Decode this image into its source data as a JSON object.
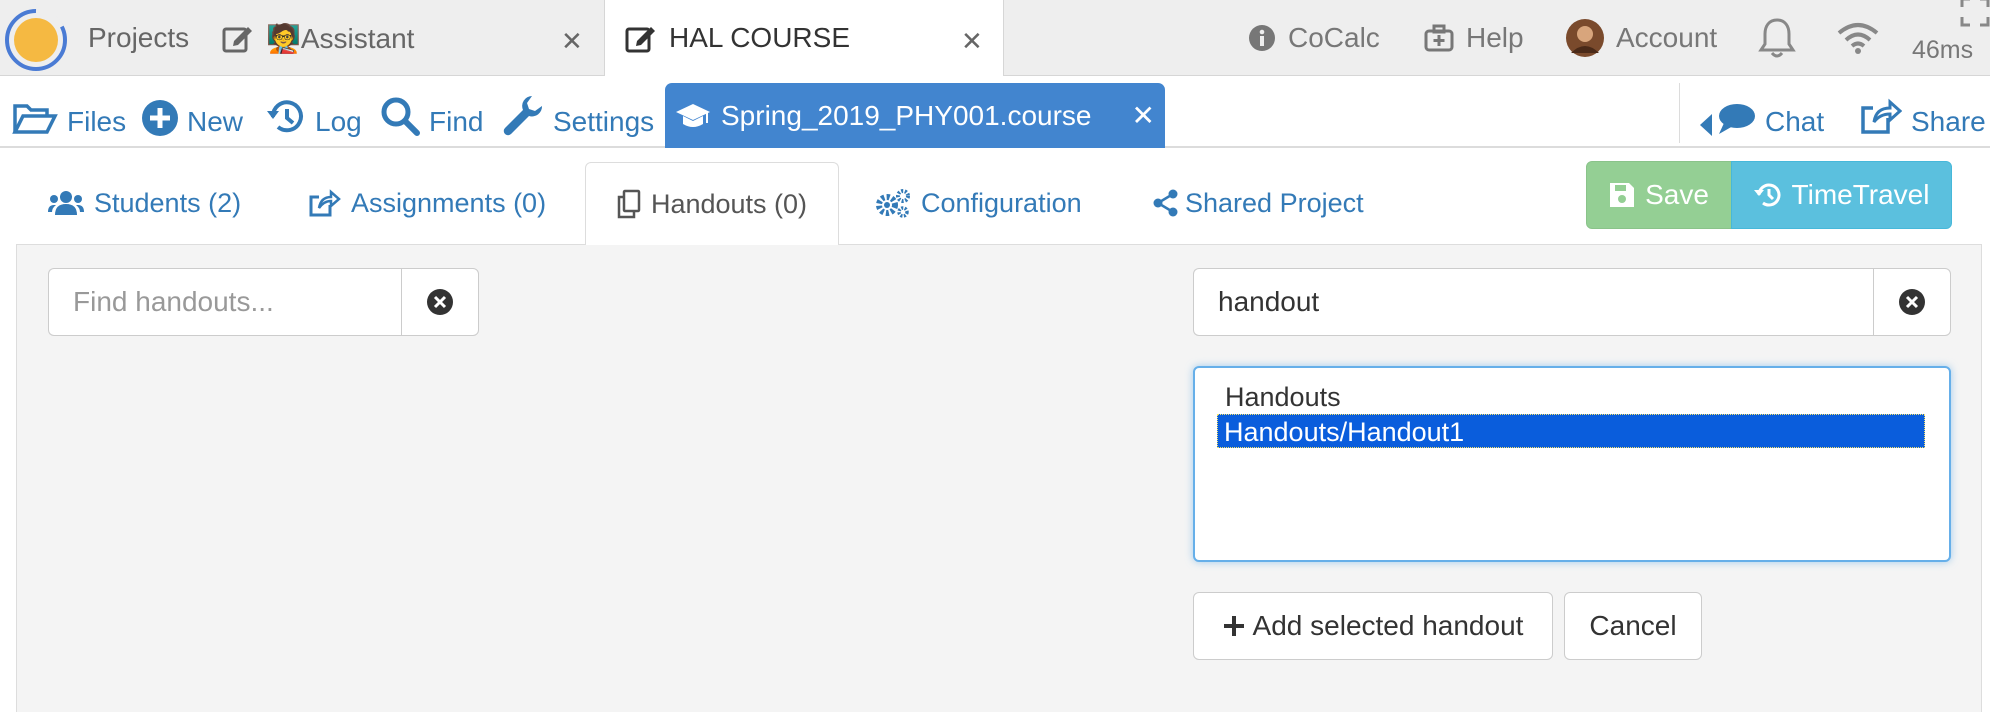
{
  "topbar": {
    "tabs": [
      {
        "label": "Projects"
      },
      {
        "label": "🧑‍🏫Assistant"
      },
      {
        "label": "HAL COURSE"
      }
    ],
    "right": {
      "cocalc": "CoCalc",
      "help": "Help",
      "account": "Account",
      "ping": "46ms"
    }
  },
  "project_toolbar": {
    "files": "Files",
    "new": "New",
    "log": "Log",
    "find": "Find",
    "settings": "Settings",
    "open_file": "Spring_2019_PHY001.course",
    "chat": "Chat",
    "share": "Share"
  },
  "course_tabs": {
    "students": "Students (2)",
    "assignments": "Assignments (0)",
    "handouts": "Handouts (0)",
    "configuration": "Configuration",
    "shared_project": "Shared Project"
  },
  "actions": {
    "save": "Save",
    "timetravel": "TimeTravel"
  },
  "handouts": {
    "filter_placeholder": "Find handouts...",
    "add_search_value": "handout",
    "directory_options": [
      "Handouts",
      "Handouts/Handout1"
    ],
    "selected_option": "Handouts/Handout1",
    "add_button": "Add selected handout",
    "cancel_button": "Cancel"
  },
  "colors": {
    "link_blue": "#337ab7",
    "file_tab_blue": "#4285cf",
    "save_green": "#94cf94",
    "timetravel_cyan": "#5bc0de",
    "selection_blue": "#0a5ddc",
    "logo_orange": "#f5b942",
    "logo_ring": "#4a7bd4"
  }
}
